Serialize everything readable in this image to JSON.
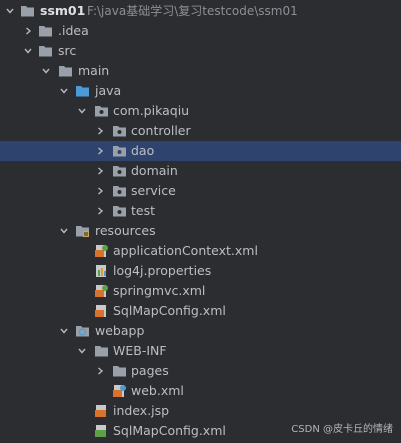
{
  "tree": {
    "root": {
      "name": "ssm01",
      "path": "F:\\java基础学习\\复习testcode\\ssm01"
    },
    "idea": "idea",
    "src": "src",
    "main": "main",
    "java": "java",
    "package": "com.pikaqiu",
    "controller": "controller",
    "dao": "dao",
    "domain": "domain",
    "service": "service",
    "test": "test",
    "resources": "resources",
    "applicationContext": "applicationContext.xml",
    "log4j": "log4j.properties",
    "springmvc": "springmvc.xml",
    "sqlMapConfig1": "SqlMapConfig.xml",
    "webapp": "webapp",
    "webinf": "WEB-INF",
    "pages": "pages",
    "webxml": "web.xml",
    "indexjsp": "index.jsp",
    "sqlMapConfig2": "SqlMapConfig.xml"
  },
  "selected_item": "dao",
  "colors": {
    "background": "#2b2d30",
    "selection": "#2e436e",
    "folder": "#9aa0aa",
    "source_folder": "#4c9bd8",
    "resource_folder": "#c9a95c",
    "text": "#bcbec4"
  },
  "watermark": "CSDN @皮卡丘的情绪"
}
